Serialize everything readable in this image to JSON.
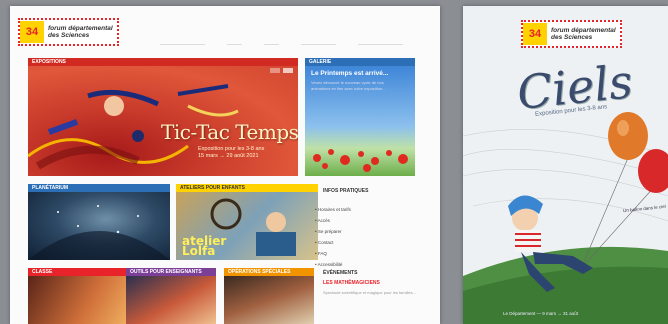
{
  "site": {
    "logo_number": "34",
    "logo_text_line1": "forum départemental",
    "logo_text_line2": "des Sciences",
    "nav": [
      "—————————",
      "———",
      "———",
      "———————",
      "—————————"
    ]
  },
  "expositions": {
    "header": "EXPOSITIONS",
    "title": "Tic-Tac Temps",
    "subtitle_line1": "Exposition pour les 3-8 ans",
    "subtitle_line2": "15 mars → 29 août 2021"
  },
  "sidebar_promo": {
    "header": "GALERIE",
    "title": "Le Printemps est arrivé...",
    "text": "Venez découvrir le nouveau cycle de nos animations en lien avec notre exposition..."
  },
  "planetarium": {
    "header": "PLANÉTARIUM"
  },
  "atelier": {
    "header": "ATELIERS POUR ENFANTS",
    "overlay": "atelier Lolfa"
  },
  "infos": {
    "title": "INFOS PRATIQUES",
    "items": [
      "Horaires et tarifs",
      "Accès",
      "Se préparer",
      "Contact",
      "FAQ",
      "Accessibilité"
    ]
  },
  "bottom_tiles": [
    {
      "header": "CLASSE"
    },
    {
      "header": "OUTILS POUR ENSEIGNANTS"
    },
    {
      "header": "OPÉRATIONS SPÉCIALES"
    }
  ],
  "events": {
    "title": "ÉVÉNEMENTS",
    "subtitle": "LES MATHÉMAGICIENS",
    "text": "Spectacle scientifique et magique pour les familles..."
  },
  "poster": {
    "logo_number": "34",
    "logo_text_line1": "forum départemental",
    "logo_text_line2": "des Sciences",
    "title": "Ciels",
    "subtitle": "Exposition pour les 3-8 ans",
    "side_caption": "Un ballon dans le ciel",
    "bottom_caption": "Le Département — 9 mars → 31 août"
  },
  "colors": {
    "brand_red": "#e8232a",
    "brand_yellow": "#ffd200",
    "blue_header": "#2c6fb6",
    "purple_header": "#7b3f98",
    "orange_header": "#f29400",
    "dark_header": "#333333"
  }
}
